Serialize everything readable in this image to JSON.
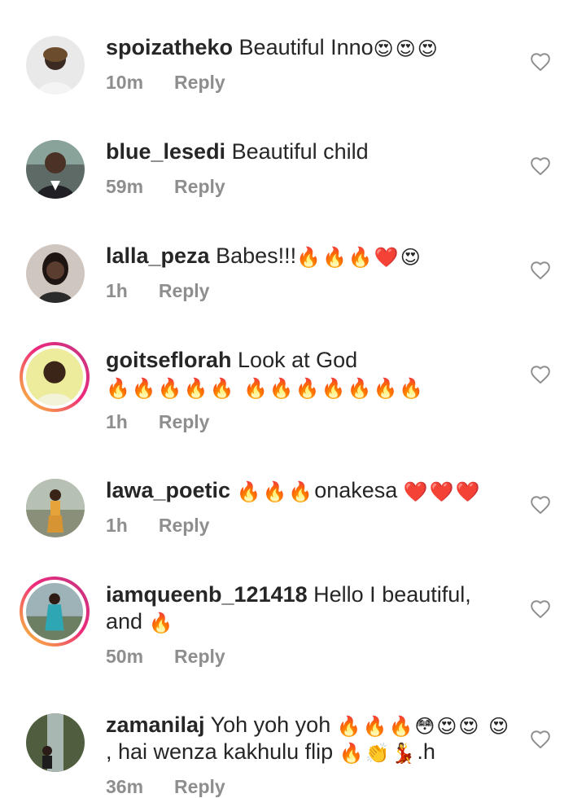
{
  "comments": [
    {
      "username": "spoizatheko",
      "text": "Beautiful Inno",
      "emoji": "😍😍😍",
      "time": "10m",
      "reply_label": "Reply",
      "like_icon": "heart-outline-icon",
      "avatar_ring": false
    },
    {
      "username": "blue_lesedi",
      "text": "Beautiful child",
      "emoji": "",
      "time": "59m",
      "reply_label": "Reply",
      "like_icon": "heart-outline-icon",
      "avatar_ring": false
    },
    {
      "username": "lalla_peza",
      "text": "Babes!!!",
      "emoji": "🔥🔥🔥❤️😍",
      "time": "1h",
      "reply_label": "Reply",
      "like_icon": "heart-outline-icon",
      "avatar_ring": false
    },
    {
      "username": "goitseflorah",
      "text": "Look at God",
      "emoji": "🔥🔥🔥🔥🔥 🔥🔥🔥🔥🔥🔥🔥",
      "time": "1h",
      "reply_label": "Reply",
      "like_icon": "heart-outline-icon",
      "avatar_ring": true
    },
    {
      "username": "lawa_poetic",
      "text_pre_emoji": "🔥🔥🔥",
      "text": "onakesa",
      "emoji": "❤️❤️❤️",
      "time": "1h",
      "reply_label": "Reply",
      "like_icon": "heart-outline-icon",
      "avatar_ring": false
    },
    {
      "username": "iamqueenb_121418",
      "text": "Hello I beautiful, and",
      "emoji": "🔥",
      "time": "50m",
      "reply_label": "Reply",
      "like_icon": "heart-outline-icon",
      "avatar_ring": true
    },
    {
      "username": "zamanilaj",
      "text": "Yoh yoh yoh",
      "emoji": "🔥🔥🔥😳😍😍 😍",
      "text_after": ", hai wenza kakhulu flip",
      "emoji_after": "🔥👏💃",
      "text_tail": ".h",
      "time": "36m",
      "reply_label": "Reply",
      "like_icon": "heart-outline-icon",
      "avatar_ring": false
    }
  ],
  "colors": {
    "text": "#262626",
    "meta": "#8e8e8e",
    "story_ring_start": "#f9ce34",
    "story_ring_end": "#c13584"
  }
}
